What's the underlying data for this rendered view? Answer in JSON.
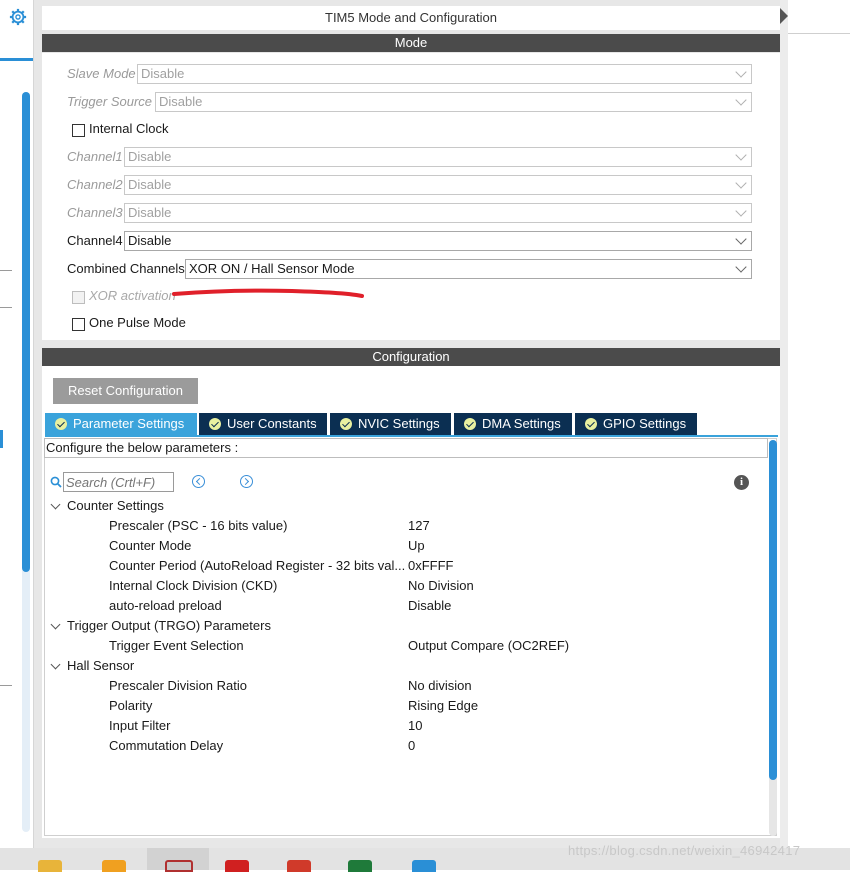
{
  "window_title": "TIM5 Mode and Configuration",
  "mode_section": {
    "header": "Mode",
    "fields": [
      {
        "label": "Slave Mode",
        "value": "Disable",
        "enabled": false
      },
      {
        "label": "Trigger Source",
        "value": "Disable",
        "enabled": false
      },
      {
        "label": "Channel1",
        "value": "Disable",
        "enabled": false
      },
      {
        "label": "Channel2",
        "value": "Disable",
        "enabled": false
      },
      {
        "label": "Channel3",
        "value": "Disable",
        "enabled": false
      },
      {
        "label": "Channel4",
        "value": "Disable",
        "enabled": true
      },
      {
        "label": "Combined Channels",
        "value": "XOR ON / Hall Sensor Mode",
        "enabled": true
      }
    ],
    "internal_clock": {
      "label": "Internal Clock",
      "checked": false
    },
    "xor_activation": {
      "label": "XOR activation",
      "checked": false,
      "enabled": false
    },
    "one_pulse_mode": {
      "label": "One Pulse Mode",
      "checked": false
    }
  },
  "config_section": {
    "header": "Configuration",
    "reset_button": "Reset Configuration",
    "tabs": [
      {
        "label": "Parameter Settings",
        "active": true
      },
      {
        "label": "User Constants",
        "active": false
      },
      {
        "label": "NVIC Settings",
        "active": false
      },
      {
        "label": "DMA Settings",
        "active": false
      },
      {
        "label": "GPIO Settings",
        "active": false
      }
    ],
    "hint": "Configure the below parameters :",
    "search_placeholder": "Search (Crtl+F)",
    "groups": [
      {
        "title": "Counter Settings",
        "params": [
          {
            "name": "Prescaler (PSC - 16 bits value)",
            "value": "127"
          },
          {
            "name": "Counter Mode",
            "value": "Up"
          },
          {
            "name": "Counter Period (AutoReload Register - 32 bits val...",
            "value": "0xFFFF"
          },
          {
            "name": "Internal Clock Division (CKD)",
            "value": "No Division"
          },
          {
            "name": "auto-reload preload",
            "value": "Disable"
          }
        ]
      },
      {
        "title": "Trigger Output (TRGO) Parameters",
        "params": [
          {
            "name": "Trigger Event Selection",
            "value": "Output Compare (OC2REF)"
          }
        ]
      },
      {
        "title": "Hall Sensor",
        "params": [
          {
            "name": "Prescaler Division Ratio",
            "value": "No division"
          },
          {
            "name": "Polarity",
            "value": "Rising Edge"
          },
          {
            "name": "Input Filter",
            "value": "10"
          },
          {
            "name": "Commutation Delay",
            "value": "0"
          }
        ]
      }
    ]
  },
  "watermark": "https://blog.csdn.net/weixin_46942417",
  "colors": {
    "accent": "#3aa3db",
    "tab_dark": "#0b2f52",
    "header_bar": "#4b4b4b",
    "annotation_red": "#e0202a"
  },
  "icons": [
    "gear-icon",
    "search-icon",
    "info-icon",
    "nav-prev-icon",
    "nav-next-icon",
    "check-icon"
  ]
}
